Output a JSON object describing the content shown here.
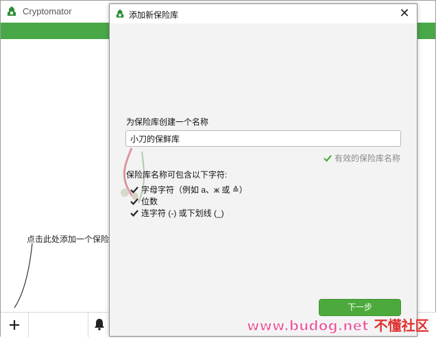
{
  "main_window": {
    "title": "Cryptomator",
    "hint": "点击此处添加一个保险",
    "add_icon": "plus-icon",
    "bell_icon": "bell-icon",
    "close_glyph": "X"
  },
  "dialog": {
    "title": "添加新保险库",
    "close_glyph": "✕",
    "name_label": "为保险库创建一个名称",
    "name_value": "小刀的保鲜库",
    "valid_text": "有效的保险库名称",
    "rules_title": "保险库名称可包含以下字符:",
    "rules": [
      "字母字符（例如 a、ж 或 ≙）",
      "位数",
      "连字符 (-) 或下划线 (_)"
    ],
    "next_label": "下一步"
  },
  "watermark": {
    "url": "www.budog.net",
    "cn": "不懂社区"
  },
  "colors": {
    "accent_green": "#48a848",
    "button_green": "#4caa3c",
    "check_green": "#4caa3c"
  }
}
